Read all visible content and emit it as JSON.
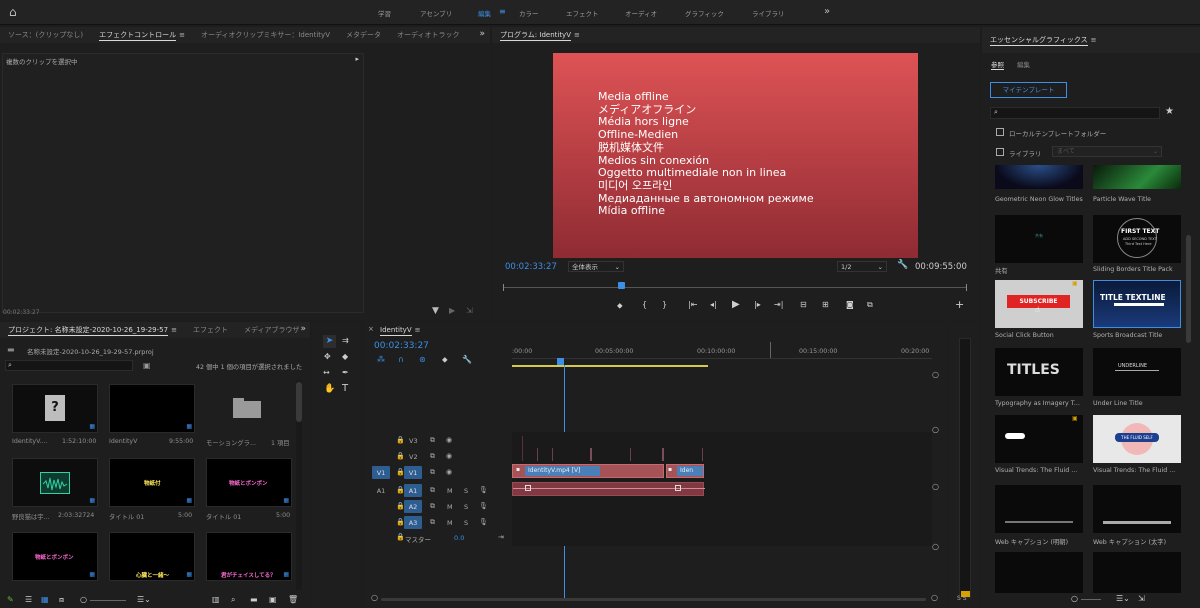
{
  "topbar": {
    "workspaces": [
      {
        "label": "学習"
      },
      {
        "label": "アセンブリ"
      },
      {
        "label": "編集",
        "active": true
      },
      {
        "label": "カラー"
      },
      {
        "label": "エフェクト"
      },
      {
        "label": "オーディオ"
      },
      {
        "label": "グラフィック"
      },
      {
        "label": "ライブラリ"
      }
    ],
    "more": "»"
  },
  "source_panel": {
    "tabs": [
      "ソース：(クリップなし)",
      "エフェクトコントロール",
      "オーディオクリップミキサー：IdentityV",
      "メタデータ",
      "オーディオトラック"
    ],
    "active_tab": 1,
    "hint": "複数のクリップを選択中",
    "timecode": "00:02:33:27"
  },
  "program": {
    "title": "プログラム: IdentityV",
    "offline_lines": [
      "Media offline",
      "メディアオフライン",
      "Média hors ligne",
      "Offline-Medien",
      "脱机媒体文件",
      "Medios sin conexión",
      "Oggetto multimediale non in linea",
      "미디어 오프라인",
      "Медиаданные в автономном режиме",
      "Mídia offline"
    ],
    "timecode": "00:02:33:27",
    "fit": "全体表示",
    "resolution": "1/2",
    "duration": "00:09:55:00",
    "colors": {
      "frame_top": "#de5355",
      "frame_bottom": "#8f2b33",
      "accent": "#3d8fe6"
    }
  },
  "project": {
    "tabs": [
      "プロジェクト: 名称未設定-2020-10-26_19-29-57",
      "エフェクト",
      "メディアブラウザ"
    ],
    "path": "名称未設定-2020-10-26_19-29-57.prproj",
    "count": "42 個中 1 個の項目が選択されました",
    "items": [
      {
        "name": "IdentityV....",
        "duration": "1:52:10:00",
        "kind": "missing"
      },
      {
        "name": "IdentityV",
        "duration": "9:55:00",
        "kind": "black"
      },
      {
        "name": "モーショングラ...",
        "duration": "1 項目",
        "kind": "folder"
      },
      {
        "name": "野良猫は宇...",
        "duration": "2:03:32724",
        "kind": "audio"
      },
      {
        "name": "タイトル 01",
        "duration": "5:00",
        "kind": "title",
        "text": "物紙付",
        "color": "#ffe85a"
      },
      {
        "name": "タイトル 01",
        "duration": "5:00",
        "kind": "title",
        "text": "物紙とボンボン",
        "color": "#ff6ad2"
      },
      {
        "name": "",
        "duration": "",
        "kind": "title",
        "text": "物紙とボンボン",
        "color": "#ff6ad2"
      },
      {
        "name": "",
        "duration": "",
        "kind": "title",
        "text": "心臓と一緒～",
        "color": "#ffe85a"
      },
      {
        "name": "",
        "duration": "",
        "kind": "title",
        "text": "君がチェイスしてる？",
        "color": "#ff6ad2"
      }
    ]
  },
  "timeline": {
    "title": "IdentityV",
    "timecode": "00:02:33:27",
    "ruler": [
      ":00:00",
      "00:05:00:00",
      "00:10:00:00",
      "00:15:00:00",
      "00:20:00"
    ],
    "video_tracks": [
      {
        "name": "V3"
      },
      {
        "name": "V2"
      },
      {
        "name": "V1",
        "source": "V1"
      }
    ],
    "audio_tracks": [
      {
        "name": "A1",
        "source": "A1"
      },
      {
        "name": "A2"
      },
      {
        "name": "A3"
      }
    ],
    "master_label": "マスター",
    "master_value": "0.0",
    "mute": "M",
    "solo": "S",
    "clip_label": "IdentityV.mp4 [V]",
    "clip_label2": "Iden",
    "meter_label": "S S"
  },
  "essential": {
    "title": "エッセンシャルグラフィックス",
    "tabs": [
      "参照",
      "編集"
    ],
    "my_templates": "マイテンプレート",
    "local_folder": "ローカルテンプレートフォルダー",
    "library": "ライブラリ",
    "library_select": "まべて",
    "templates": [
      {
        "label": "Geometric Neon Glow Titles",
        "style": "neon"
      },
      {
        "label": "Particle Wave Title",
        "style": "wave"
      },
      {
        "label": "共有",
        "style": "share"
      },
      {
        "label": "Sliding Borders Title Pack",
        "style": "sliding"
      },
      {
        "label": "Social Click Button",
        "style": "subscribe"
      },
      {
        "label": "Sports Broadcast Title",
        "style": "sports"
      },
      {
        "label": "Typography as Imagery T...",
        "style": "titles"
      },
      {
        "label": "Under Line Title",
        "style": "underline"
      },
      {
        "label": "Visual Trends: The Fluid ...",
        "style": "fluid1"
      },
      {
        "label": "Visual Trends: The Fluid ...",
        "style": "fluid2"
      },
      {
        "label": "Web キャプション (明朝)",
        "style": "web1"
      },
      {
        "label": "Web キャプション (太字)",
        "style": "web2"
      }
    ],
    "sliding_text": [
      "FIRST TEXT",
      "ADD SECOND TEXT",
      "Third Text Here"
    ],
    "subscribe_text": "SUBSCRIBE",
    "sports_text": "TITLE TEXTLINE",
    "titles_text": "TITLES",
    "underline_text": "UNDERLINE",
    "fluid_text": "THE FLUID SELF"
  }
}
